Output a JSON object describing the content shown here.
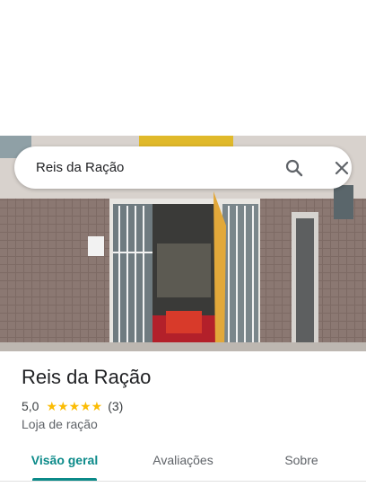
{
  "search": {
    "query": "Reis da Ração"
  },
  "place": {
    "name": "Reis da Ração",
    "rating": "5,0",
    "stars": "★★★★★",
    "review_count": "(3)",
    "category": "Loja de ração"
  },
  "tabs": [
    {
      "label": "Visão geral",
      "active": true
    },
    {
      "label": "Avaliações",
      "active": false
    },
    {
      "label": "Sobre",
      "active": false
    }
  ],
  "colors": {
    "accent": "#0b8a89",
    "star": "#fbbc04"
  },
  "icons": [
    "search-icon",
    "close-icon"
  ]
}
